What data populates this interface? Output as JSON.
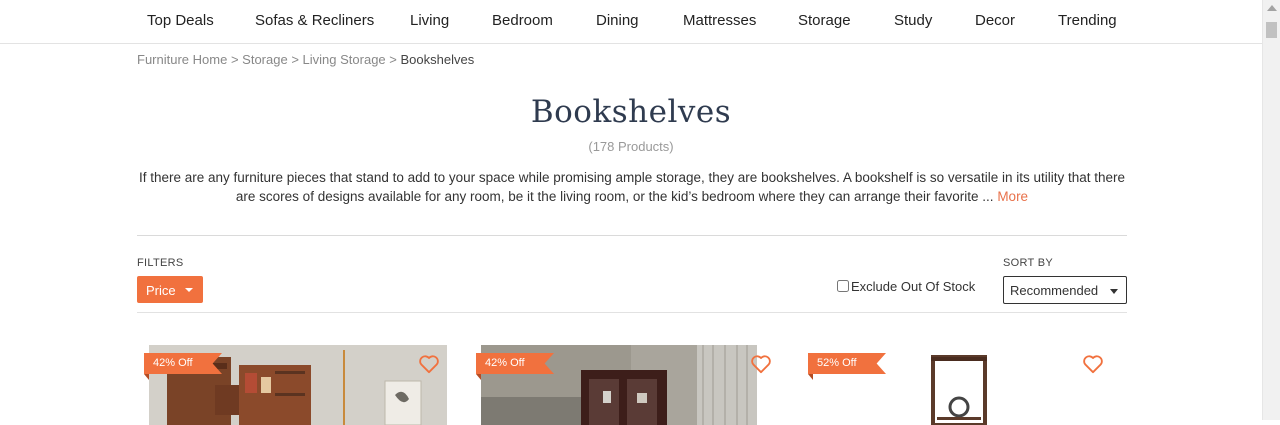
{
  "nav": {
    "items": [
      "Top Deals",
      "Sofas & Recliners",
      "Living",
      "Bedroom",
      "Dining",
      "Mattresses",
      "Storage",
      "Study",
      "Decor",
      "Trending"
    ]
  },
  "breadcrumb": {
    "items": [
      "Furniture Home",
      "Storage",
      "Living Storage"
    ],
    "separator": ">",
    "current": "Bookshelves"
  },
  "page": {
    "title": "Bookshelves",
    "count": "(178 Products)",
    "description": "If there are any furniture pieces that stand to add to your space while promising ample storage, they are bookshelves. A bookshelf is so versatile in its utility that there are scores of designs available for any room, be it the living room, or the kid’s bedroom where they can arrange their favorite ...",
    "more_label": "More"
  },
  "filters": {
    "label": "FILTERS",
    "price_label": "Price",
    "exclude_label": "Exclude Out Of Stock",
    "exclude_checked": false,
    "sort_label": "SORT BY",
    "sort_value": "Recommended"
  },
  "products": [
    {
      "discount": "42% Off",
      "icon": "heart-icon"
    },
    {
      "discount": "42% Off",
      "icon": "heart-icon"
    },
    {
      "discount": "52% Off",
      "icon": "heart-icon"
    }
  ],
  "colors": {
    "accent": "#f1713e",
    "title": "#2f3b4f"
  }
}
